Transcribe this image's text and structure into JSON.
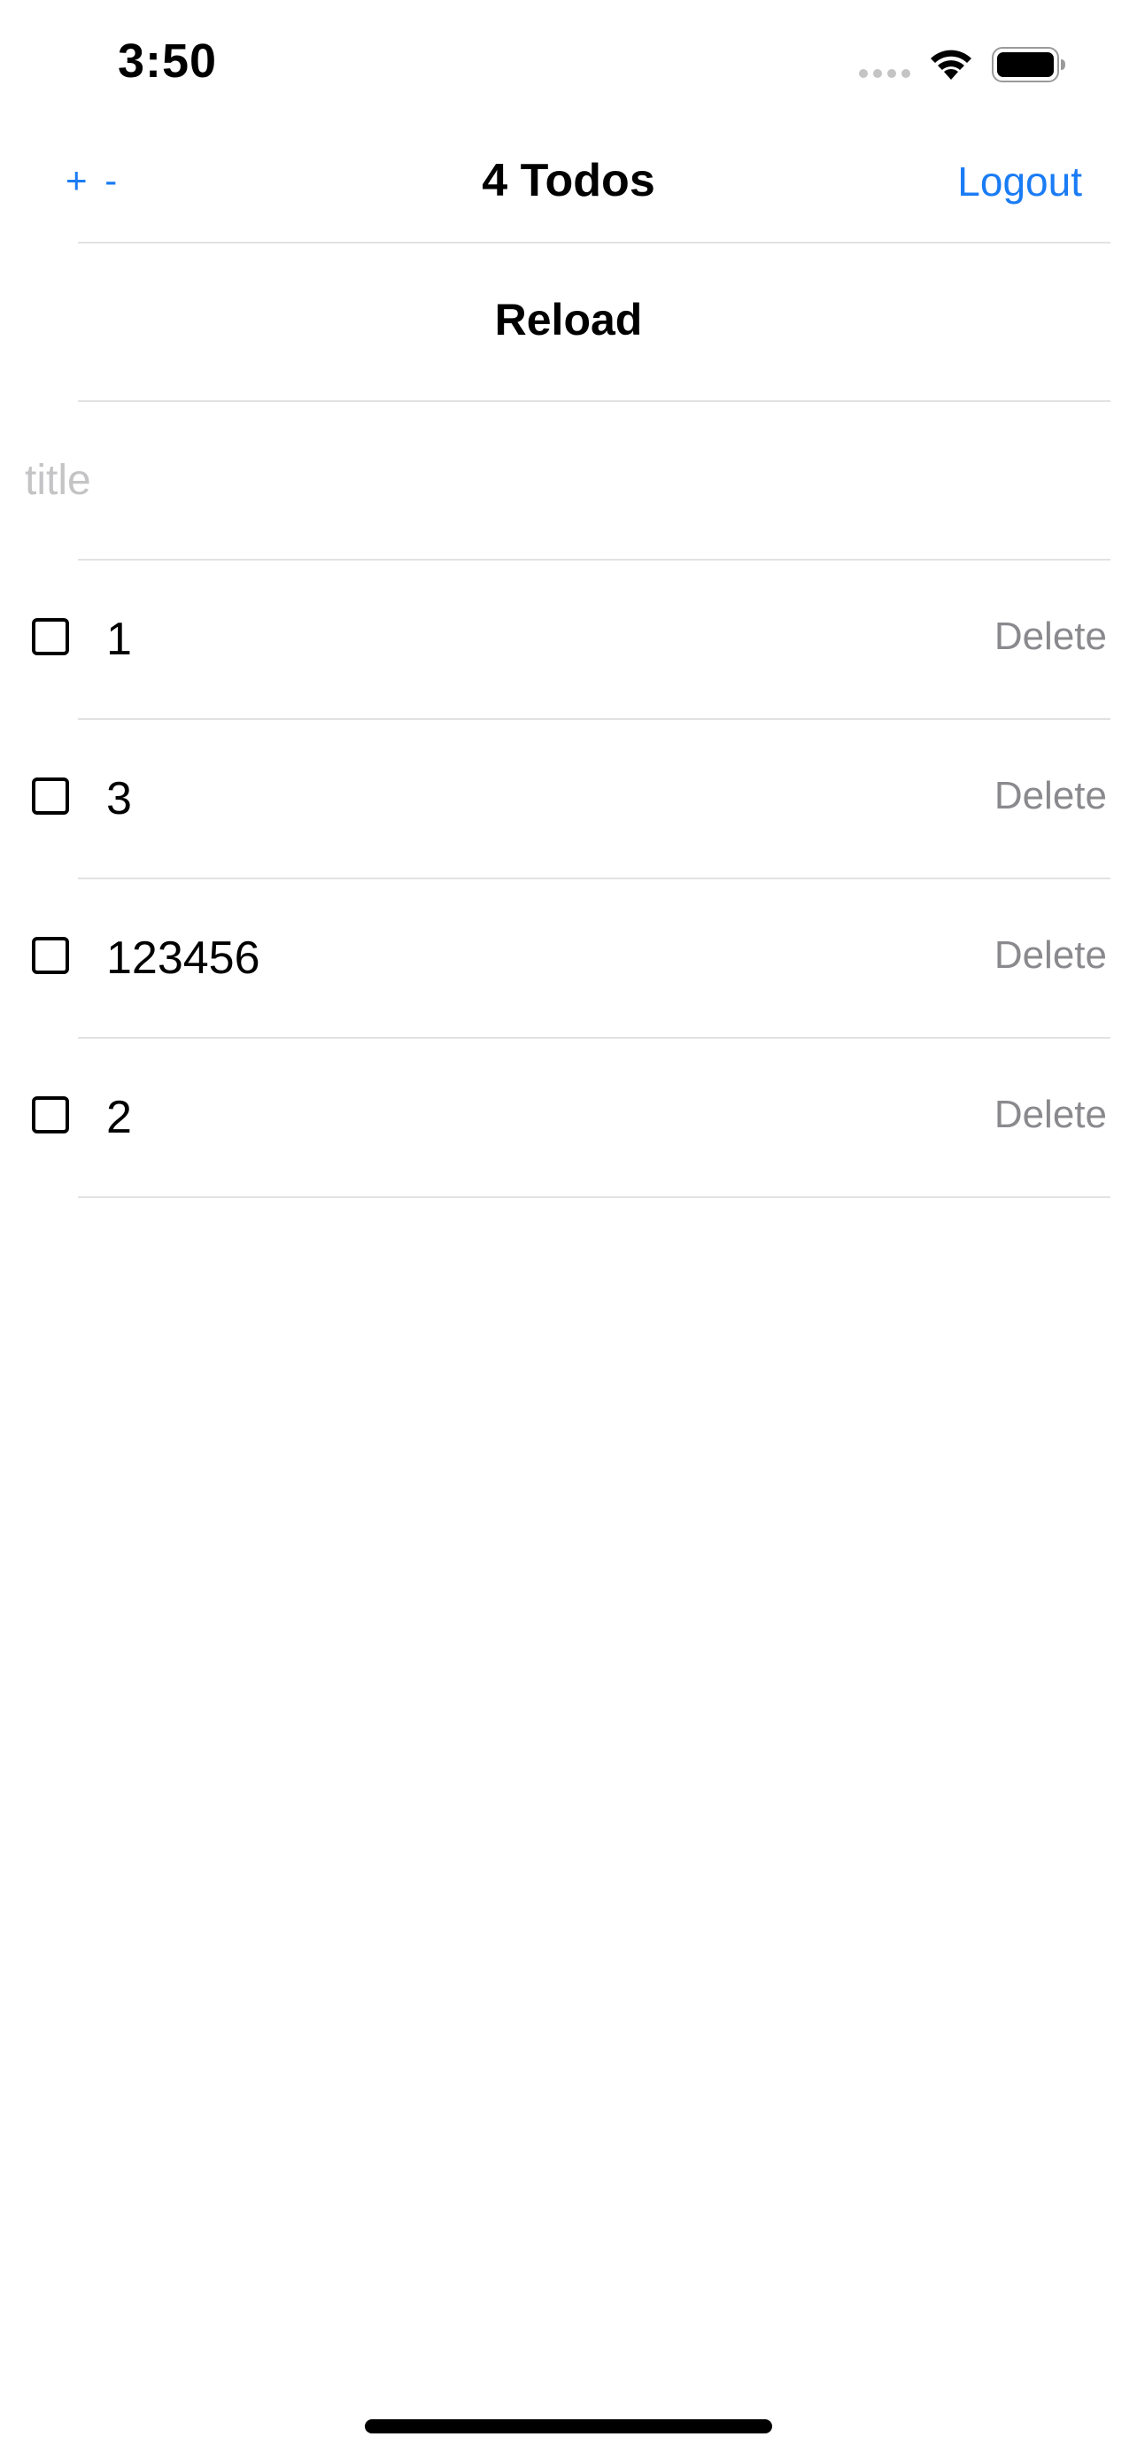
{
  "status_bar": {
    "time": "3:50",
    "icons": [
      "signal-dots-icon",
      "wifi-icon",
      "battery-icon"
    ]
  },
  "nav": {
    "left_label": "+ -",
    "title": "4 Todos",
    "right_label": "Logout",
    "accent_color": "#1a7cf5"
  },
  "reload": {
    "label": "Reload"
  },
  "new_todo": {
    "placeholder": "title",
    "value": ""
  },
  "todos": [
    {
      "title": "1",
      "done": false,
      "action": "Delete"
    },
    {
      "title": "3",
      "done": false,
      "action": "Delete"
    },
    {
      "title": "123456",
      "done": false,
      "action": "Delete"
    },
    {
      "title": "2",
      "done": false,
      "action": "Delete"
    }
  ]
}
